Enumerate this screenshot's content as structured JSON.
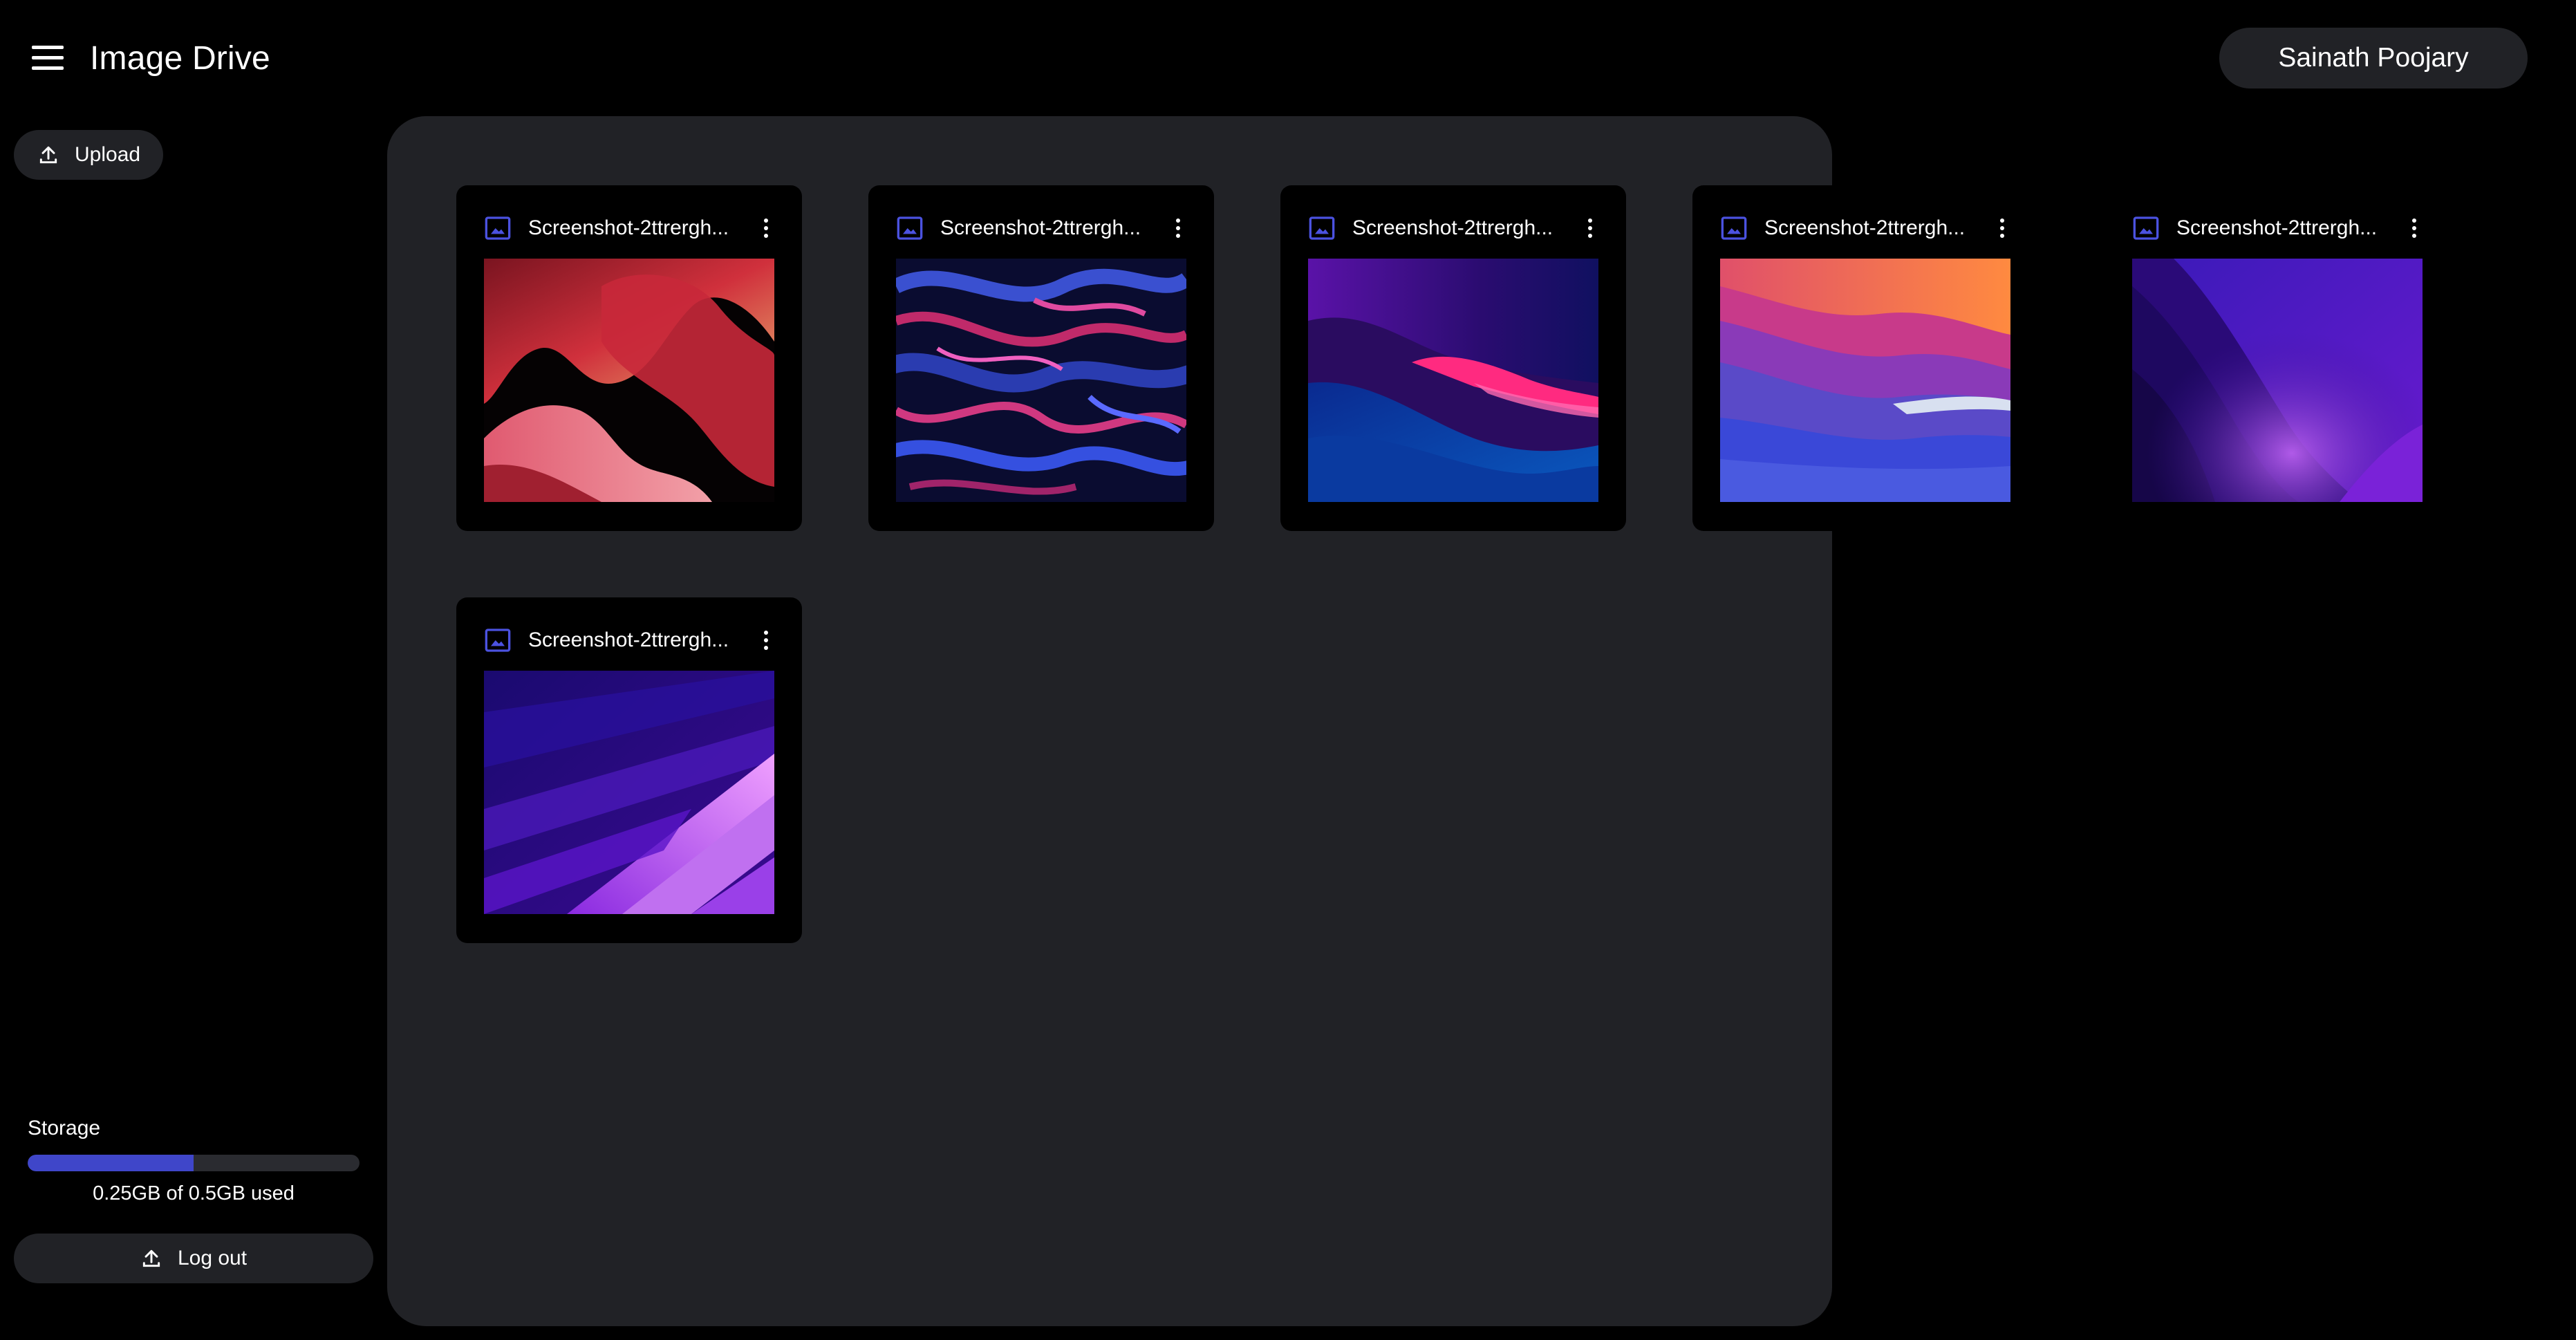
{
  "header": {
    "title": "Image Drive",
    "user_name": "Sainath Poojary"
  },
  "sidebar": {
    "upload_label": "Upload",
    "storage_label": "Storage",
    "storage_used_gb": 0.25,
    "storage_total_gb": 0.5,
    "storage_fraction": 0.5,
    "storage_text": "0.25GB of 0.5GB used",
    "logout_label": "Log out"
  },
  "colors": {
    "accent": "#3f46c9",
    "panel": "#212226",
    "background": "#000000"
  },
  "files": [
    {
      "name": "Screenshot-2ttrergh...",
      "icon": "image-icon",
      "palette": "red-waves"
    },
    {
      "name": "Screenshot-2ttrergh...",
      "icon": "image-icon",
      "palette": "blue-swirl"
    },
    {
      "name": "Screenshot-2ttrergh...",
      "icon": "image-icon",
      "palette": "purple-dunes"
    },
    {
      "name": "Screenshot-2ttrergh...",
      "icon": "image-icon",
      "palette": "orange-blue-waves"
    },
    {
      "name": "Screenshot-2ttrergh...",
      "icon": "image-icon",
      "palette": "violet-mountain"
    },
    {
      "name": "Screenshot-2ttrergh...",
      "icon": "image-icon",
      "palette": "purple-streaks"
    }
  ]
}
